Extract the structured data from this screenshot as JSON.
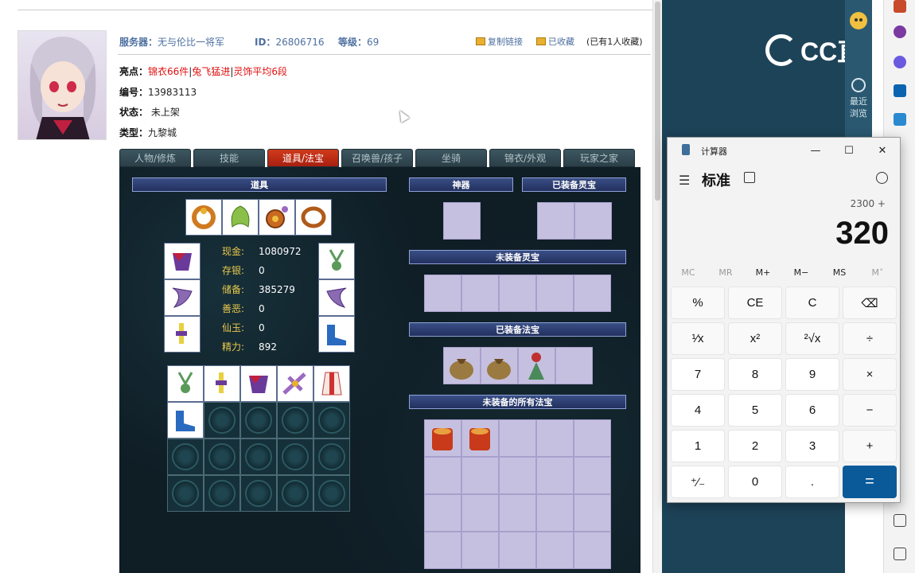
{
  "header": {
    "server_label": "服务器：",
    "server_value": "无与伦比一将军",
    "id_label": "ID：",
    "id_value": "26806716",
    "level_label": "等级：",
    "level_value": "69",
    "copy_link": "复制链接",
    "favorited": "已收藏",
    "fav_count": "(已有1人收藏)"
  },
  "info": {
    "highlight_label": "亮点：",
    "highlights": [
      "锦衣66件",
      "|",
      "兔飞猛进",
      "|",
      "灵饰平均6段"
    ],
    "number_label": "编号：",
    "number_value": "13983113",
    "status_label": "状态：",
    "status_value": "未上架",
    "type_label": "类型：",
    "type_value": "九黎城"
  },
  "tabs": [
    "人物/修炼",
    "技能",
    "道具/法宝",
    "召唤兽/孩子",
    "坐骑",
    "锦衣/外观",
    "玩家之家"
  ],
  "active_tab": 2,
  "sections": {
    "items": "道具",
    "artifact": "神器",
    "equipped_lingbao": "已装备灵宝",
    "unequipped_lingbao": "未装备灵宝",
    "equipped_fabao": "已装备法宝",
    "unequipped_fabao": "未装备的所有法宝"
  },
  "stats": [
    {
      "label": "现金:",
      "value": "1080972"
    },
    {
      "label": "存银:",
      "value": "0"
    },
    {
      "label": "储备:",
      "value": "385279"
    },
    {
      "label": "善恶:",
      "value": "0"
    },
    {
      "label": "仙玉:",
      "value": "0"
    },
    {
      "label": "精力:",
      "value": "892"
    }
  ],
  "overlay": {
    "brand": "CC直播",
    "recent_1": "最近",
    "recent_2": "浏览"
  },
  "calculator": {
    "title": "计算器",
    "mode": "标准",
    "expression": "2300 +",
    "display": "320",
    "memory": [
      "MC",
      "MR",
      "M+",
      "M−",
      "MS",
      "M˅"
    ],
    "keys": [
      [
        "%",
        "CE",
        "C",
        "⌫"
      ],
      [
        "¹⁄x",
        "x²",
        "²√x",
        "÷"
      ],
      [
        "7",
        "8",
        "9",
        "×"
      ],
      [
        "4",
        "5",
        "6",
        "−"
      ],
      [
        "1",
        "2",
        "3",
        "+"
      ],
      [
        "⁺∕₋",
        "0",
        ".",
        "="
      ]
    ]
  },
  "colors": {
    "accent_red": "#e01010",
    "link_blue": "#4d6fa0",
    "panel_bg": "#0f1d25",
    "section_blue": "#2a3a70",
    "calc_equals": "#0a5a9a"
  }
}
